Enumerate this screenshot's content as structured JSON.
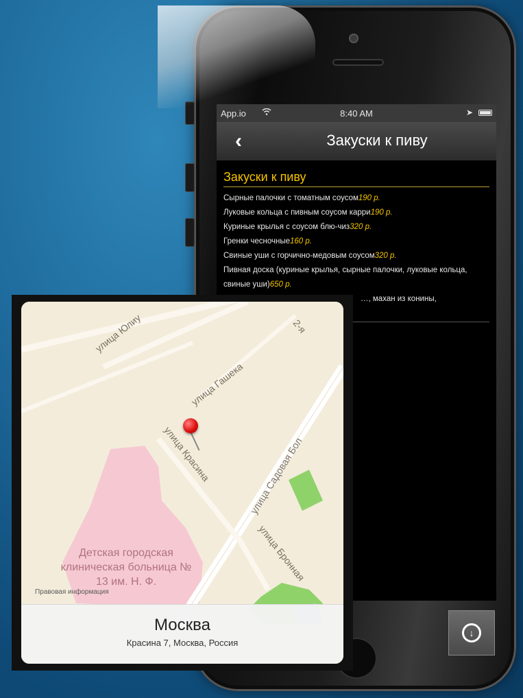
{
  "status_bar": {
    "carrier": "App.io",
    "time": "8:40 AM"
  },
  "nav": {
    "back_icon": "chevron-left-icon",
    "title": "Закуски к пиву"
  },
  "section": {
    "title": "Закуски к пиву",
    "items": [
      {
        "name": "Сырные палочки с томатным соусом",
        "price": "190 р."
      },
      {
        "name": "Луковые кольца с пивным соусом карри",
        "price": "190 р."
      },
      {
        "name": "Куриные крылья с соусом блю-чиз",
        "price": "320 р."
      },
      {
        "name": "Гренки чесночные",
        "price": "160 р."
      },
      {
        "name": "Свиные уши с горчично-медовым соусом",
        "price": "320 р."
      },
      {
        "name": "Пивная доска (куриные крылья, сырные палочки, луковые кольца, свиные уши)",
        "price": "650 р."
      },
      {
        "name": "…, махан из конины,",
        "price": ""
      }
    ]
  },
  "map": {
    "streets": [
      "улица Юлиу",
      "улица Гашека",
      "улица Красина",
      "улица Садовая Бол",
      "улица Бронная",
      "2-я"
    ],
    "hospital": "Детская городская клиническая больница № 13 им. Н. Ф.",
    "legal": "Правовая информация",
    "place_name": "Москва",
    "place_address": "Красина 7, Москва, Россия"
  },
  "download_button": {
    "icon": "download-circle-icon"
  },
  "colors": {
    "accent": "#f5c400",
    "background": "#1f6c9e"
  }
}
